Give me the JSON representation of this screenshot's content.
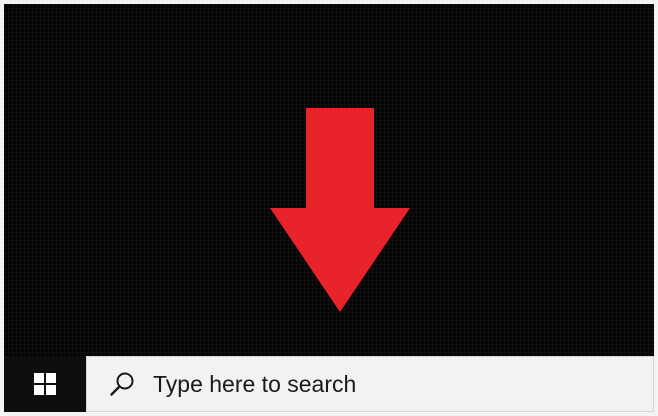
{
  "desktop": {
    "background_color": "#050505",
    "pointer_arrow": {
      "icon": "down-arrow-icon",
      "color": "#e8232a"
    }
  },
  "taskbar": {
    "background_color": "#0e0e0e",
    "start_button": {
      "icon": "windows-logo-icon",
      "color": "#ffffff"
    },
    "search": {
      "icon": "search-icon",
      "placeholder": "Type here to search",
      "background_color": "#f2f2f2"
    }
  }
}
